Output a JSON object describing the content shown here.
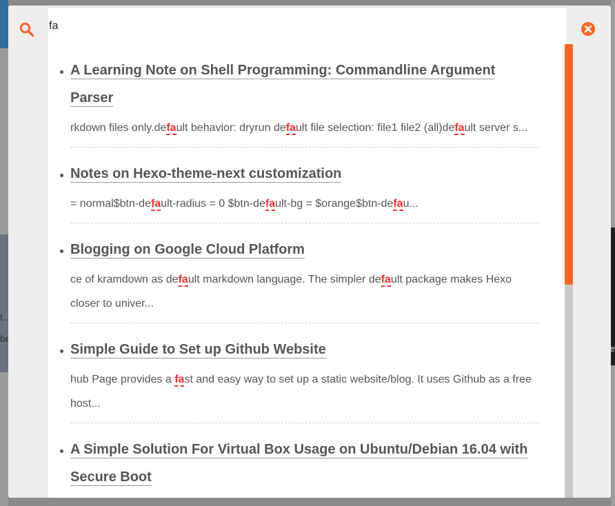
{
  "search": {
    "value": "fa",
    "placeholder": ""
  },
  "colors": {
    "accent": "#fc6423",
    "highlight": "#ff2a2a"
  },
  "icons": {
    "search": "search-icon",
    "close": "close-icon"
  },
  "background": {
    "left_text_a": "t..",
    "left_text_b": "be",
    "right_text": "e"
  },
  "results": [
    {
      "title": "A Learning Note on Shell Programming: Commandline Argument Parser",
      "excerpt": [
        {
          "t": "rkdown files only.de"
        },
        {
          "h": "fa"
        },
        {
          "t": "ult behavior: dryrun de"
        },
        {
          "h": "fa"
        },
        {
          "t": "ult file selection: file1 file2 (all)de"
        },
        {
          "h": "fa"
        },
        {
          "t": "ult server s..."
        }
      ]
    },
    {
      "title": "Notes on Hexo-theme-next customization",
      "excerpt": [
        {
          "t": "= normal$btn-de"
        },
        {
          "h": "fa"
        },
        {
          "t": "ult-radius = 0 $btn-de"
        },
        {
          "h": "fa"
        },
        {
          "t": "ult-bg = $orange$btn-de"
        },
        {
          "h": "fa"
        },
        {
          "t": "u..."
        }
      ]
    },
    {
      "title": "Blogging on Google Cloud Platform",
      "excerpt": [
        {
          "t": "ce of kramdown as de"
        },
        {
          "h": "fa"
        },
        {
          "t": "ult markdown language. The simpler de"
        },
        {
          "h": "fa"
        },
        {
          "t": "ult package makes Hexo closer to univer..."
        }
      ]
    },
    {
      "title": "Simple Guide to Set up Github Website",
      "excerpt": [
        {
          "t": "hub Page provides a "
        },
        {
          "h": "fa"
        },
        {
          "t": "st and easy way to set up a static website/blog. It uses Github as a free host..."
        }
      ]
    },
    {
      "title": "A Simple Solution For Virtual Box Usage on Ubuntu/Debian 16.04 with Secure Boot",
      "excerpt": []
    }
  ],
  "scrollbar": {
    "position": 0.0,
    "visible_fraction": 0.53
  }
}
